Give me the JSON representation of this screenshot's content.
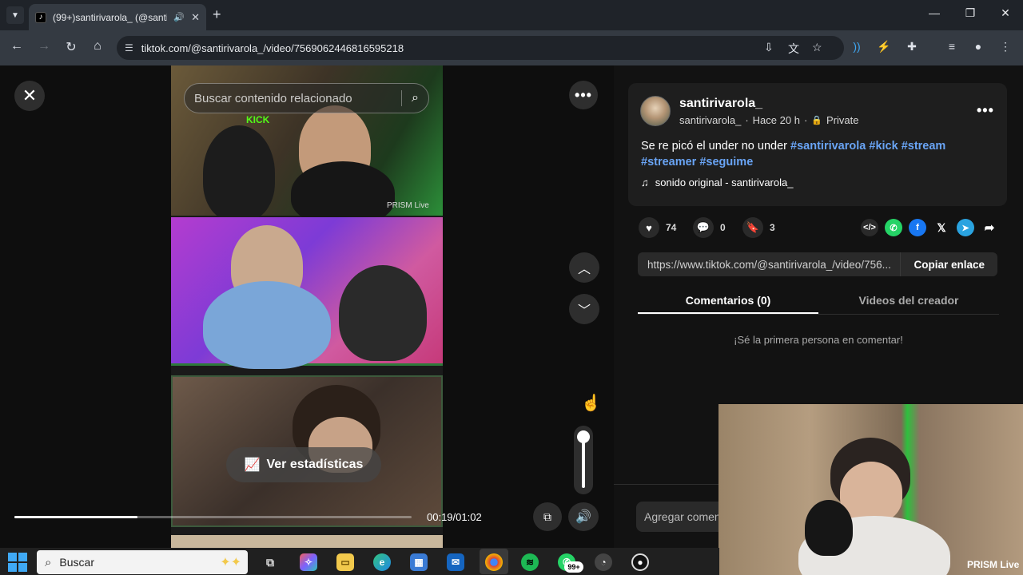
{
  "browser": {
    "tab_title": "(99+)santirivarola_ (@santir",
    "tab_favicon": "tiktok-icon",
    "url": "tiktok.com/@santirivarola_/video/7569062446816595218",
    "window_controls": [
      "minimize-icon",
      "restore-icon",
      "close-icon"
    ]
  },
  "video": {
    "search_placeholder": "Buscar contenido relacionado",
    "stats_label": "Ver estadísticas",
    "time_display": "00:19/01:02",
    "progress_fraction": 0.31,
    "volume_fraction": 1.0,
    "overlay_kick": "KICK",
    "overlay_prism": "PRISM Live"
  },
  "post": {
    "username": "santirivarola_",
    "handle": "santirivarola_",
    "time_ago": "Hace 20 h",
    "privacy": "Private",
    "caption_text": "Se re picó el under no under",
    "hashtags": [
      "#santirivarola",
      "#kick",
      "#stream",
      "#streamer",
      "#seguime"
    ],
    "music": "sonido original - santirivarola_",
    "likes": "74",
    "comments": "0",
    "saves": "3",
    "share_icons": [
      "embed-icon",
      "whatsapp-icon",
      "facebook-icon",
      "x-icon",
      "telegram-icon",
      "share-arrow-icon"
    ],
    "link_url": "https://www.tiktok.com/@santirivarola_/video/756...",
    "copy_link_label": "Copiar enlace",
    "tabs": [
      "Comentarios (0)",
      "Videos del creador"
    ],
    "empty_comments": "¡Sé la primera persona en comentar!",
    "comment_placeholder": "Agregar comen"
  },
  "webcam": {
    "label": "PRISM Live"
  },
  "taskbar": {
    "search_label": "Buscar",
    "whatsapp_badge": "99+",
    "colors": {
      "start": "#3fa9f5",
      "chrome": "#db4437",
      "spotify": "#1db954",
      "whatsapp": "#25d366"
    }
  },
  "colors": {
    "hashtag": "#69a4f5",
    "kick_green": "#53fc18"
  }
}
